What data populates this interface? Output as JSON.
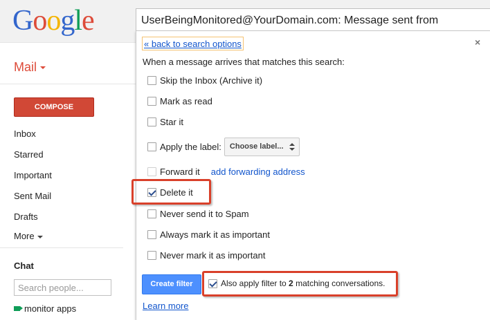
{
  "header": {
    "logo_letters": [
      "G",
      "o",
      "o",
      "g",
      "l",
      "e"
    ],
    "search_value": "UserBeingMonitored@YourDomain.com: Message sent from"
  },
  "sidebar": {
    "mail_label": "Mail",
    "compose_label": "COMPOSE",
    "nav_items": [
      "Inbox",
      "Starred",
      "Important",
      "Sent Mail",
      "Drafts"
    ],
    "more_label": "More",
    "chat_label": "Chat",
    "chat_search_placeholder": "Search people...",
    "chat_contact": "monitor apps"
  },
  "filter_panel": {
    "back_link": "« back to search options",
    "close_glyph": "×",
    "intro": "When a message arrives that matches this search:",
    "options": {
      "skip_inbox": {
        "label": "Skip the Inbox (Archive it)",
        "checked": false
      },
      "mark_read": {
        "label": "Mark as read",
        "checked": false
      },
      "star": {
        "label": "Star it",
        "checked": false
      },
      "apply_label": {
        "label": "Apply the label:",
        "checked": false,
        "select_value": "Choose label..."
      },
      "forward": {
        "label": "Forward it",
        "checked": false,
        "link": "add forwarding address"
      },
      "delete": {
        "label": "Delete it",
        "checked": true
      },
      "never_spam": {
        "label": "Never send it to Spam",
        "checked": false
      },
      "always_important": {
        "label": "Always mark it as important",
        "checked": false
      },
      "never_important": {
        "label": "Never mark it as important",
        "checked": false
      }
    },
    "create_button": "Create filter",
    "also_apply": {
      "prefix": "Also apply filter to ",
      "count": "2",
      "suffix": " matching conversations.",
      "checked": true
    },
    "learn_more": "Learn more"
  },
  "colors": {
    "brand_red": "#dd4b39",
    "compose_red": "#d14836",
    "link_blue": "#1155cc",
    "button_blue": "#4d90fe",
    "highlight_red": "#d9402a"
  }
}
